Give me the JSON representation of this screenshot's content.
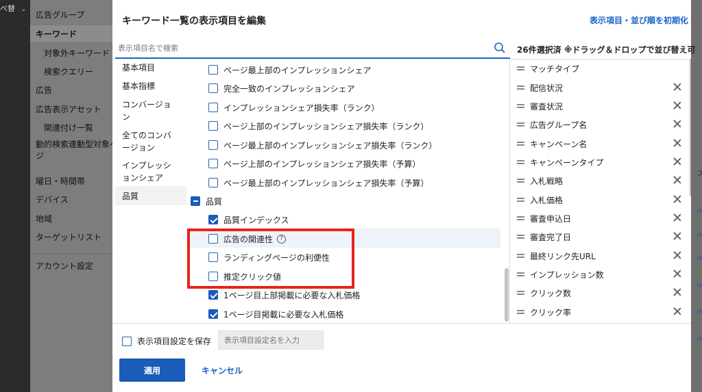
{
  "leftstrip": {
    "cut_text": "べ替"
  },
  "sidenav": {
    "items": [
      {
        "label": "広告グループ"
      },
      {
        "label": "キーワード"
      },
      {
        "label": "対象外キーワード"
      },
      {
        "label": "検索クエリー"
      },
      {
        "label": "広告"
      },
      {
        "label": "広告表示アセット"
      },
      {
        "label": "関連付け一覧"
      },
      {
        "label": "動的検索連動型対象ペ"
      },
      {
        "label": "ジ"
      },
      {
        "label": "曜日・時間帯"
      },
      {
        "label": "デバイス"
      },
      {
        "label": "地域"
      },
      {
        "label": "ターゲットリスト"
      },
      {
        "label": "アカウント設定"
      }
    ]
  },
  "modal": {
    "title": "キーワード一覧の表示項目を編集",
    "reset_link": "表示項目・並び順を初期化",
    "search_placeholder": "表示項目名で検索",
    "categories": [
      {
        "label": "基本項目"
      },
      {
        "label": "基本指標"
      },
      {
        "label": "コンバージョ"
      },
      {
        "label": "ン"
      },
      {
        "label": "全てのコンバ"
      },
      {
        "label": "ージョン"
      },
      {
        "label": "インプレッシ"
      },
      {
        "label": "ョンシェア"
      },
      {
        "label": "品質"
      }
    ],
    "options": [
      {
        "label": "ページ最上部のインプレッションシェア",
        "checked": false
      },
      {
        "label": "完全一致のインプレッションシェア",
        "checked": false
      },
      {
        "label": "インプレッションシェア損失率（ランク）",
        "checked": false
      },
      {
        "label": "ページ上部のインプレッションシェア損失率（ランク）",
        "checked": false
      },
      {
        "label": "ページ最上部のインプレッションシェア損失率（ランク）",
        "checked": false
      },
      {
        "label": "ページ上部のインプレッションシェア損失率（予算）",
        "checked": false
      },
      {
        "label": "ページ最上部のインプレッションシェア損失率（予算）",
        "checked": false
      }
    ],
    "quality_group": {
      "label": "品質",
      "options": [
        {
          "label": "品質インデックス",
          "checked": true
        },
        {
          "label": "広告の関連性",
          "checked": false
        },
        {
          "label": "ランディングページの利便性",
          "checked": false
        },
        {
          "label": "推定クリック値",
          "checked": false
        },
        {
          "label": "1ページ目上部掲載に必要な入札価格",
          "checked": true
        },
        {
          "label": "1ページ目掲載に必要な入札価格",
          "checked": true
        }
      ]
    },
    "help_glyph": "?",
    "selected_header": "26件選択済 ※ドラッグ＆ドロップで並び替え可",
    "selected": [
      {
        "label": "マッチタイプ"
      },
      {
        "label": "配信状況"
      },
      {
        "label": "審査状況"
      },
      {
        "label": "広告グループ名"
      },
      {
        "label": "キャンペーン名"
      },
      {
        "label": "キャンペーンタイプ"
      },
      {
        "label": "入札戦略"
      },
      {
        "label": "入札価格"
      },
      {
        "label": "審査申込日"
      },
      {
        "label": "審査完了日"
      },
      {
        "label": "最終リンク先URL"
      },
      {
        "label": "インプレッション数"
      },
      {
        "label": "クリック数"
      },
      {
        "label": "クリック率"
      }
    ],
    "footer": {
      "save_label": "表示項目設定を保存",
      "name_placeholder": "表示項目設定名を入力",
      "apply_label": "適用",
      "cancel_label": "キャンセル"
    }
  },
  "right_edge": {
    "fragments": [
      "フ",
      "ie",
      "ie",
      "ie",
      "ie",
      "ie",
      "ie"
    ]
  },
  "colors": {
    "accent": "#1a5cb8",
    "link": "#1a62c5",
    "highlight": "#e8231a"
  }
}
